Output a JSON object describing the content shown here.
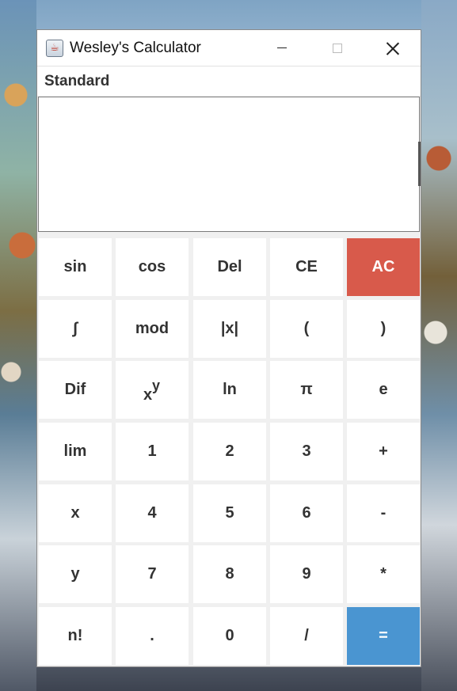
{
  "window": {
    "title": "Wesley's Calculator",
    "icon": "java-cup-icon"
  },
  "menu": {
    "items": [
      "Standard"
    ]
  },
  "display": {
    "value": ""
  },
  "colors": {
    "ac_button": "#d85a4b",
    "equals_button": "#4a95d1",
    "key_background": "#ffffff",
    "key_text": "#333333"
  },
  "keys": {
    "row1": [
      "sin",
      "cos",
      "Del",
      "CE",
      "AC"
    ],
    "row2": [
      "∫",
      "mod",
      "|x|",
      "(",
      ")"
    ],
    "row3": [
      "Dif",
      "x^y",
      "ln",
      "π",
      "e"
    ],
    "power": {
      "base": "x",
      "exp": "y"
    },
    "row4": [
      "lim",
      "1",
      "2",
      "3",
      "+"
    ],
    "row5": [
      "x",
      "4",
      "5",
      "6",
      "-"
    ],
    "row6": [
      "y",
      "7",
      "8",
      "9",
      "*"
    ],
    "row7": [
      "n!",
      ".",
      "0",
      "/",
      "="
    ]
  }
}
